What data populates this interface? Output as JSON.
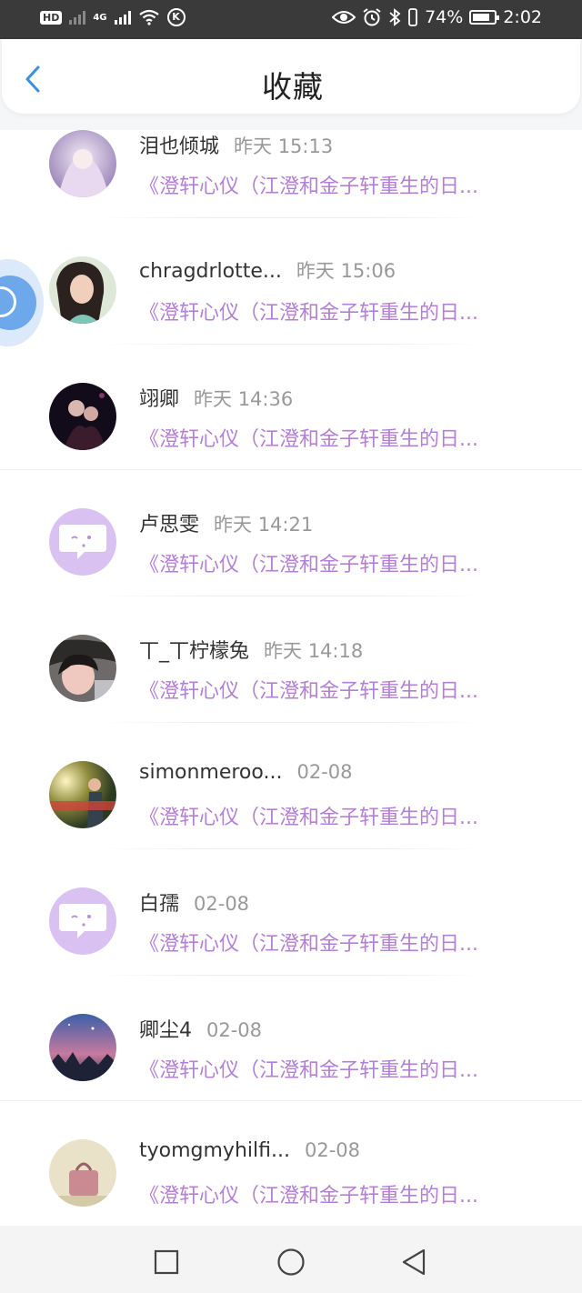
{
  "status_bar": {
    "left_badge": "HD",
    "network": "4G",
    "battery_text": "74%",
    "time": "2:02"
  },
  "header": {
    "title": "收藏",
    "back_icon": "chevron-left-icon"
  },
  "colors": {
    "accent_blue": "#3a8fe0",
    "book_purple": "#b47fd6",
    "time_gray": "#999999"
  },
  "items": [
    {
      "name": "泪也倾城",
      "time": "昨天 15:13",
      "book": "《澄轩心仪（江澄和金子轩重生的日...",
      "avatar": "photo-avatar"
    },
    {
      "name": "chragdrlotte...",
      "time": "昨天 15:06",
      "book": "《澄轩心仪（江澄和金子轩重生的日...",
      "avatar": "photo-avatar"
    },
    {
      "name": "翊卿",
      "time": "昨天 14:36",
      "book": "《澄轩心仪（江澄和金子轩重生的日...",
      "avatar": "photo-avatar"
    },
    {
      "name": "卢思雯",
      "time": "昨天 14:21",
      "book": "《澄轩心仪（江澄和金子轩重生的日...",
      "avatar": "default-avatar"
    },
    {
      "name": "丅_丅柠檬兔",
      "time": "昨天 14:18",
      "book": "《澄轩心仪（江澄和金子轩重生的日...",
      "avatar": "photo-avatar"
    },
    {
      "name": "simonmeroo...",
      "time": "02-08",
      "book": "《澄轩心仪（江澄和金子轩重生的日...",
      "avatar": "photo-avatar"
    },
    {
      "name": "白孺",
      "time": "02-08",
      "book": "《澄轩心仪（江澄和金子轩重生的日...",
      "avatar": "default-avatar"
    },
    {
      "name": "卿尘4",
      "time": "02-08",
      "book": "《澄轩心仪（江澄和金子轩重生的日...",
      "avatar": "photo-avatar"
    },
    {
      "name": "tyomgmyhilfi...",
      "time": "02-08",
      "book": "《澄轩心仪（江澄和金子轩重生的日...",
      "avatar": "photo-avatar"
    }
  ],
  "nav": {
    "recent_icon": "square-icon",
    "home_icon": "circle-icon",
    "back_icon": "triangle-back-icon"
  }
}
